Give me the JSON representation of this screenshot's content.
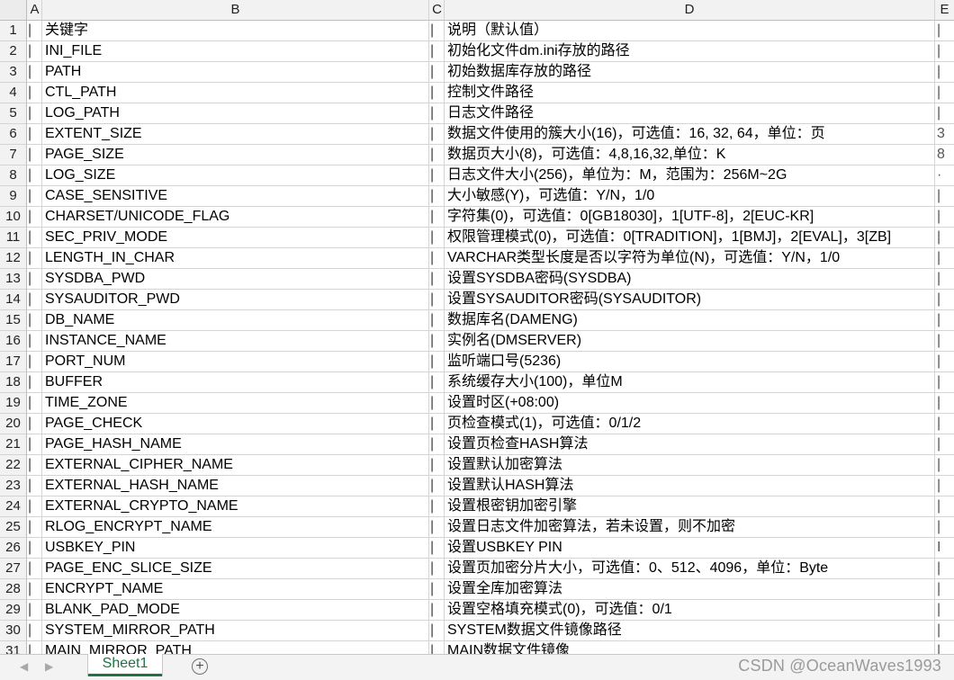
{
  "columns": [
    "A",
    "B",
    "C",
    "D",
    "E"
  ],
  "bar_char": "|",
  "rows": [
    {
      "n": "1",
      "b": "关键字",
      "d": "说明（默认值）",
      "e": "|"
    },
    {
      "n": "2",
      "b": "INI_FILE",
      "d": "初始化文件dm.ini存放的路径",
      "e": "|"
    },
    {
      "n": "3",
      "b": "PATH",
      "d": "初始数据库存放的路径",
      "e": "|"
    },
    {
      "n": "4",
      "b": "CTL_PATH",
      "d": "控制文件路径",
      "e": "|"
    },
    {
      "n": "5",
      "b": "LOG_PATH",
      "d": "日志文件路径",
      "e": "|"
    },
    {
      "n": "6",
      "b": "EXTENT_SIZE",
      "d": "数据文件使用的簇大小(16)，可选值：16, 32, 64，单位：页",
      "e": "3"
    },
    {
      "n": "7",
      "b": "PAGE_SIZE",
      "d": "数据页大小(8)，可选值：4,8,16,32,单位：K",
      "e": "8"
    },
    {
      "n": "8",
      "b": "LOG_SIZE",
      "d": "日志文件大小(256)，单位为：M，范围为：256M~2G",
      "e": "·"
    },
    {
      "n": "9",
      "b": "CASE_SENSITIVE",
      "d": "大小敏感(Y)，可选值：Y/N，1/0",
      "e": "|"
    },
    {
      "n": "10",
      "b": "CHARSET/UNICODE_FLAG",
      "d": "字符集(0)，可选值：0[GB18030]，1[UTF-8]，2[EUC-KR]",
      "e": "|"
    },
    {
      "n": "11",
      "b": "SEC_PRIV_MODE",
      "d": "权限管理模式(0)，可选值：0[TRADITION]，1[BMJ]，2[EVAL]，3[ZB]",
      "e": "|"
    },
    {
      "n": "12",
      "b": "LENGTH_IN_CHAR",
      "d": "VARCHAR类型长度是否以字符为单位(N)，可选值：Y/N，1/0",
      "e": "|"
    },
    {
      "n": "13",
      "b": "SYSDBA_PWD",
      "d": "设置SYSDBA密码(SYSDBA)",
      "e": "|"
    },
    {
      "n": "14",
      "b": "SYSAUDITOR_PWD",
      "d": "设置SYSAUDITOR密码(SYSAUDITOR)",
      "e": "|"
    },
    {
      "n": "15",
      "b": "DB_NAME",
      "d": "数据库名(DAMENG)",
      "e": "|"
    },
    {
      "n": "16",
      "b": "INSTANCE_NAME",
      "d": "实例名(DMSERVER)",
      "e": "|"
    },
    {
      "n": "17",
      "b": "PORT_NUM",
      "d": "监听端口号(5236)",
      "e": "|"
    },
    {
      "n": "18",
      "b": "BUFFER",
      "d": "系统缓存大小(100)，单位M",
      "e": "|"
    },
    {
      "n": "19",
      "b": "TIME_ZONE",
      "d": "设置时区(+08:00)",
      "e": "|"
    },
    {
      "n": "20",
      "b": "PAGE_CHECK",
      "d": "页检查模式(1)，可选值：0/1/2",
      "e": "|"
    },
    {
      "n": "21",
      "b": "PAGE_HASH_NAME",
      "d": "设置页检查HASH算法",
      "e": "|"
    },
    {
      "n": "22",
      "b": "EXTERNAL_CIPHER_NAME",
      "d": "设置默认加密算法",
      "e": "|"
    },
    {
      "n": "23",
      "b": "EXTERNAL_HASH_NAME",
      "d": "设置默认HASH算法",
      "e": "|"
    },
    {
      "n": "24",
      "b": "EXTERNAL_CRYPTO_NAME",
      "d": "设置根密钥加密引擎",
      "e": "|"
    },
    {
      "n": "25",
      "b": "RLOG_ENCRYPT_NAME",
      "d": "设置日志文件加密算法，若未设置，则不加密",
      "e": "|"
    },
    {
      "n": "26",
      "b": "USBKEY_PIN",
      "d": "设置USBKEY PIN",
      "e": "I"
    },
    {
      "n": "27",
      "b": "PAGE_ENC_SLICE_SIZE",
      "d": "设置页加密分片大小，可选值：0、512、4096，单位：Byte",
      "e": "|"
    },
    {
      "n": "28",
      "b": "ENCRYPT_NAME",
      "d": "设置全库加密算法",
      "e": "|"
    },
    {
      "n": "29",
      "b": "BLANK_PAD_MODE",
      "d": "设置空格填充模式(0)，可选值：0/1",
      "e": "|"
    },
    {
      "n": "30",
      "b": "SYSTEM_MIRROR_PATH",
      "d": "SYSTEM数据文件镜像路径",
      "e": "|"
    },
    {
      "n": "31",
      "b": "MAIN_MIRROR_PATH",
      "d": "MAIN数据文件镜像",
      "e": "|"
    }
  ],
  "tabbar": {
    "prev_icon": "◀",
    "next_icon": "▶",
    "sheet_tab": "Sheet1",
    "add_icon": "+"
  },
  "watermark": "CSDN @OceanWaves1993"
}
